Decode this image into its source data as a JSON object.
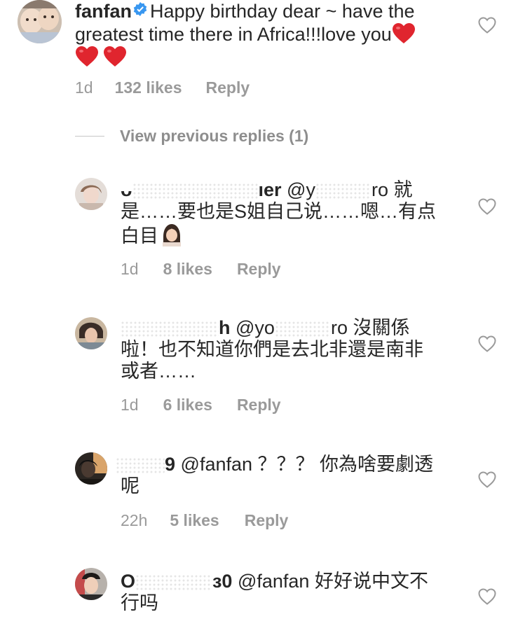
{
  "top_comment": {
    "username": "fanfan",
    "text_line1": "Happy birthday dear ~ have the",
    "text_line2": "greatest time there in Africa!!!love you",
    "time": "1d",
    "likes": "132 likes",
    "reply": "Reply"
  },
  "view_previous": "View previous replies (1)",
  "replies": [
    {
      "username_start": "ᴗ",
      "username_end": "ıer",
      "mention_start": "@y",
      "mention_end": "ro",
      "text_after_mention": "就",
      "line2": "是……要也是S姐自己说……嗯…有点",
      "line3": "白目",
      "time": "1d",
      "likes": "8 likes",
      "reply": "Reply"
    },
    {
      "username_start": "",
      "username_end": "h",
      "mention_start": "@yo",
      "mention_end": "ro",
      "text_after_mention": "沒關係",
      "line2": "啦！也不知道你們是去北非還是南非",
      "line3": "或者……",
      "time": "1d",
      "likes": "6 likes",
      "reply": "Reply"
    },
    {
      "username_start": "",
      "username_end": "9",
      "mention": "@fanfan",
      "text_after_mention": "？？？ 你為啥要劇透",
      "line2": "呢",
      "time": "22h",
      "likes": "5 likes",
      "reply": "Reply"
    },
    {
      "username_start": "O",
      "username_end": "ɜ0",
      "mention": "@fanfan",
      "text_after_mention": "好好说中文不",
      "line2": "行吗"
    }
  ],
  "colors": {
    "text": "#262626",
    "meta": "#9a9a9a",
    "heart_emoji": "#e0252e",
    "verified": "#3897f0"
  },
  "icons": {
    "like": "heart-outline-icon",
    "verified": "verified-badge-icon",
    "emoji_heart": "red-heart-emoji",
    "emoji_facepalm": "facepalm-emoji"
  }
}
